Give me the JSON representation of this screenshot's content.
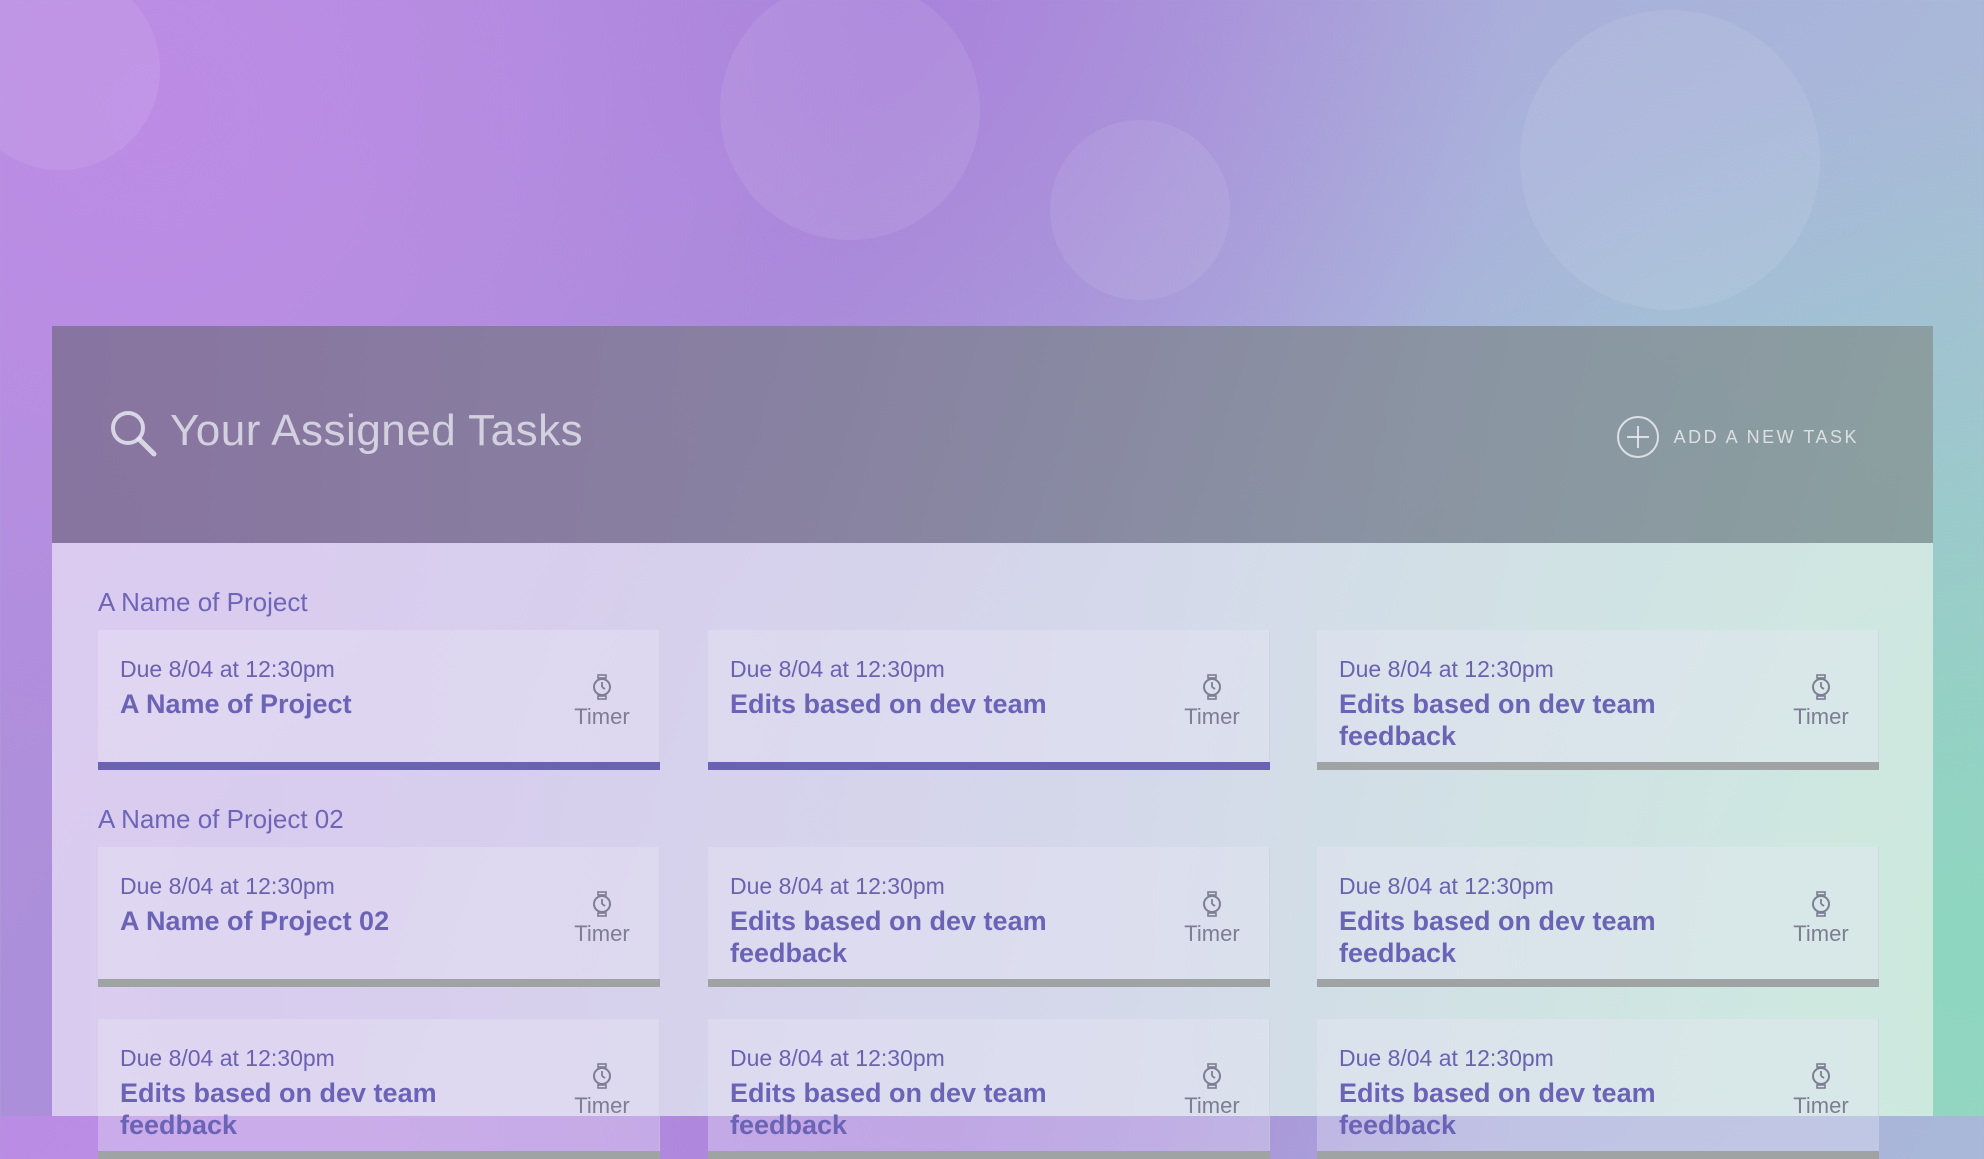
{
  "header": {
    "title": "Your Assigned Tasks",
    "add_task_label": "ADD A NEW TASK"
  },
  "projects": [
    {
      "name": "A Name of Project",
      "tasks": [
        {
          "due": "Due 8/04 at 12:30pm",
          "name": "A Name of Project",
          "timer": "Timer",
          "active": true
        },
        {
          "due": "Due 8/04 at 12:30pm",
          "name": "Edits based on dev team",
          "timer": "Timer",
          "active": true
        },
        {
          "due": "Due 8/04 at 12:30pm",
          "name": "Edits based on dev team feedback",
          "timer": "Timer",
          "active": false
        }
      ]
    },
    {
      "name": "A Name of Project 02",
      "tasks": [
        {
          "due": "Due 8/04 at 12:30pm",
          "name": "A Name of Project 02",
          "timer": "Timer",
          "active": false
        },
        {
          "due": "Due 8/04 at 12:30pm",
          "name": "Edits based on dev team feedback",
          "timer": "Timer",
          "active": false
        },
        {
          "due": "Due 8/04 at 12:30pm",
          "name": "Edits based on dev team feedback",
          "timer": "Timer",
          "active": false
        }
      ]
    },
    {
      "name": "",
      "tasks": [
        {
          "due": "Due 8/04 at 12:30pm",
          "name": "Edits based on dev team feedback",
          "timer": "Timer",
          "active": false
        },
        {
          "due": "Due 8/04 at 12:30pm",
          "name": "Edits based on dev team feedback",
          "timer": "Timer",
          "active": false
        },
        {
          "due": "Due 8/04 at 12:30pm",
          "name": "Edits based on dev team feedback",
          "timer": "Timer",
          "active": false
        }
      ]
    }
  ],
  "colors": {
    "accent": "#6a63b5",
    "inactive_bar": "#9fa3a4"
  },
  "icons": {
    "search": "search-icon",
    "add": "plus-circle-icon",
    "timer": "stopwatch-icon"
  }
}
